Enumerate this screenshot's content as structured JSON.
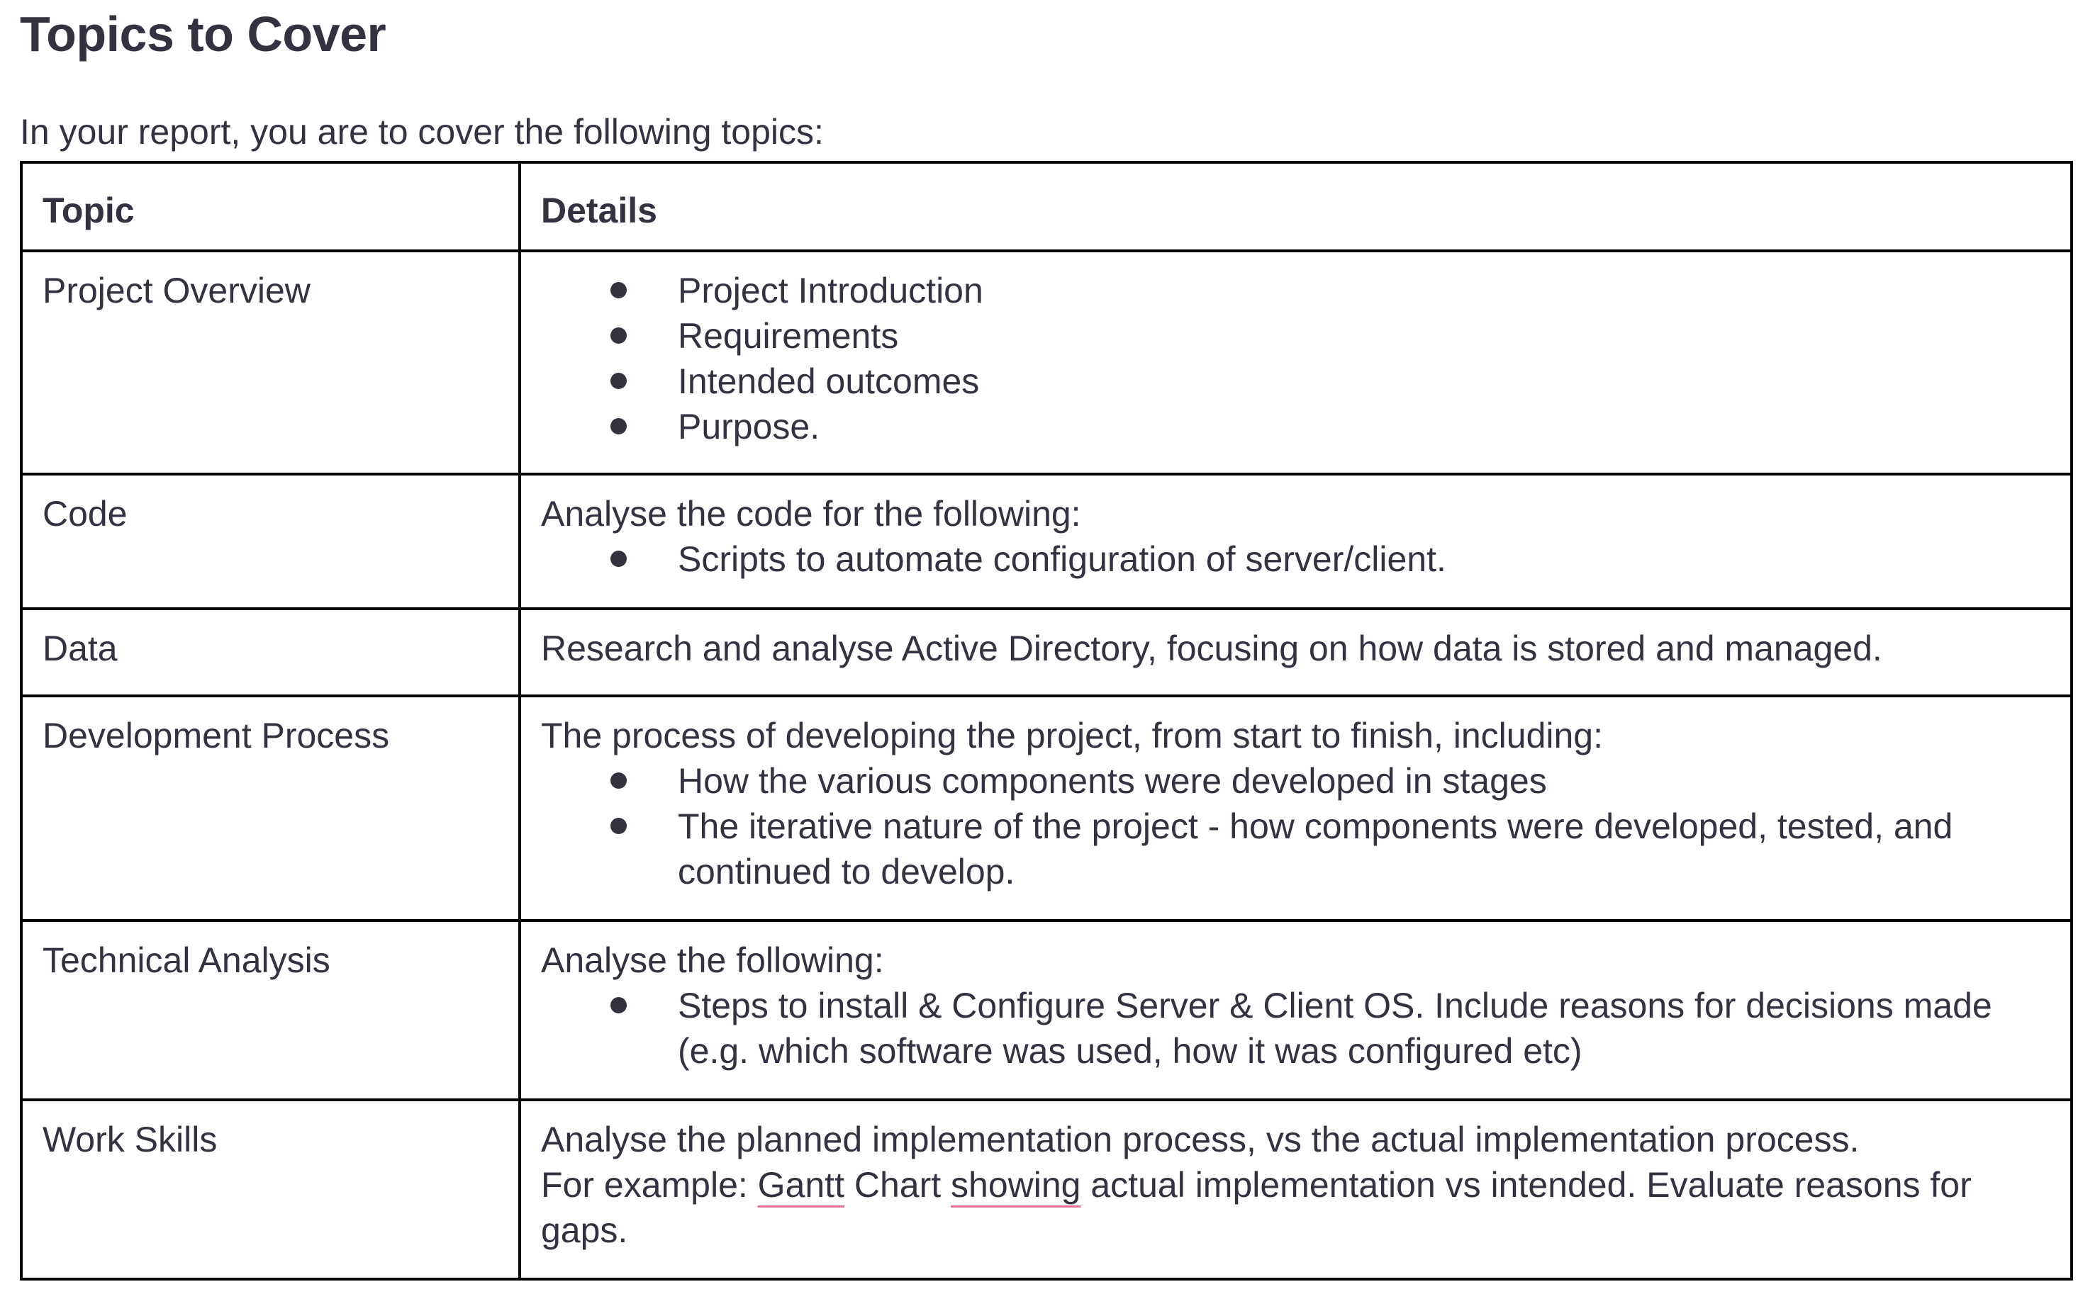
{
  "heading": "Topics to Cover",
  "intro": "In your report, you are to cover the following topics:",
  "table": {
    "headers": [
      "Topic",
      "Details"
    ],
    "rows": [
      {
        "topic": "Project Overview",
        "bullets": [
          "Project Introduction",
          "Requirements",
          "Intended outcomes",
          "Purpose."
        ]
      },
      {
        "topic": "Code",
        "lead": "Analyse the code for the following:",
        "bullets": [
          "Scripts to automate configuration of server/client."
        ]
      },
      {
        "topic": "Data",
        "lead": "Research and analyse Active Directory, focusing on how data is stored and managed."
      },
      {
        "topic": "Development Process",
        "lead": "The process of developing the project, from start to finish, including:",
        "bullets": [
          "How the various components were developed in stages",
          "The iterative nature of the project - how components were developed, tested, and continued to develop."
        ]
      },
      {
        "topic": "Technical Analysis",
        "lead": "Analyse the following:",
        "bullets": [
          "Steps to install & Configure Server & Client OS. Include reasons for decisions made (e.g. which software was used, how it was configured etc)"
        ]
      },
      {
        "topic": "Work Skills",
        "lead": "Analyse the planned implementation process, vs the actual implementation process.",
        "example_prefix": "For example: ",
        "example_word1": "Gantt",
        "example_mid": " Chart ",
        "example_word2": "showing",
        "example_rest": " actual implementation vs intended. Evaluate reasons for gaps."
      }
    ]
  },
  "colors": {
    "text": "#363141",
    "border": "#000000",
    "spellcheck_underline": "#e26d95"
  }
}
